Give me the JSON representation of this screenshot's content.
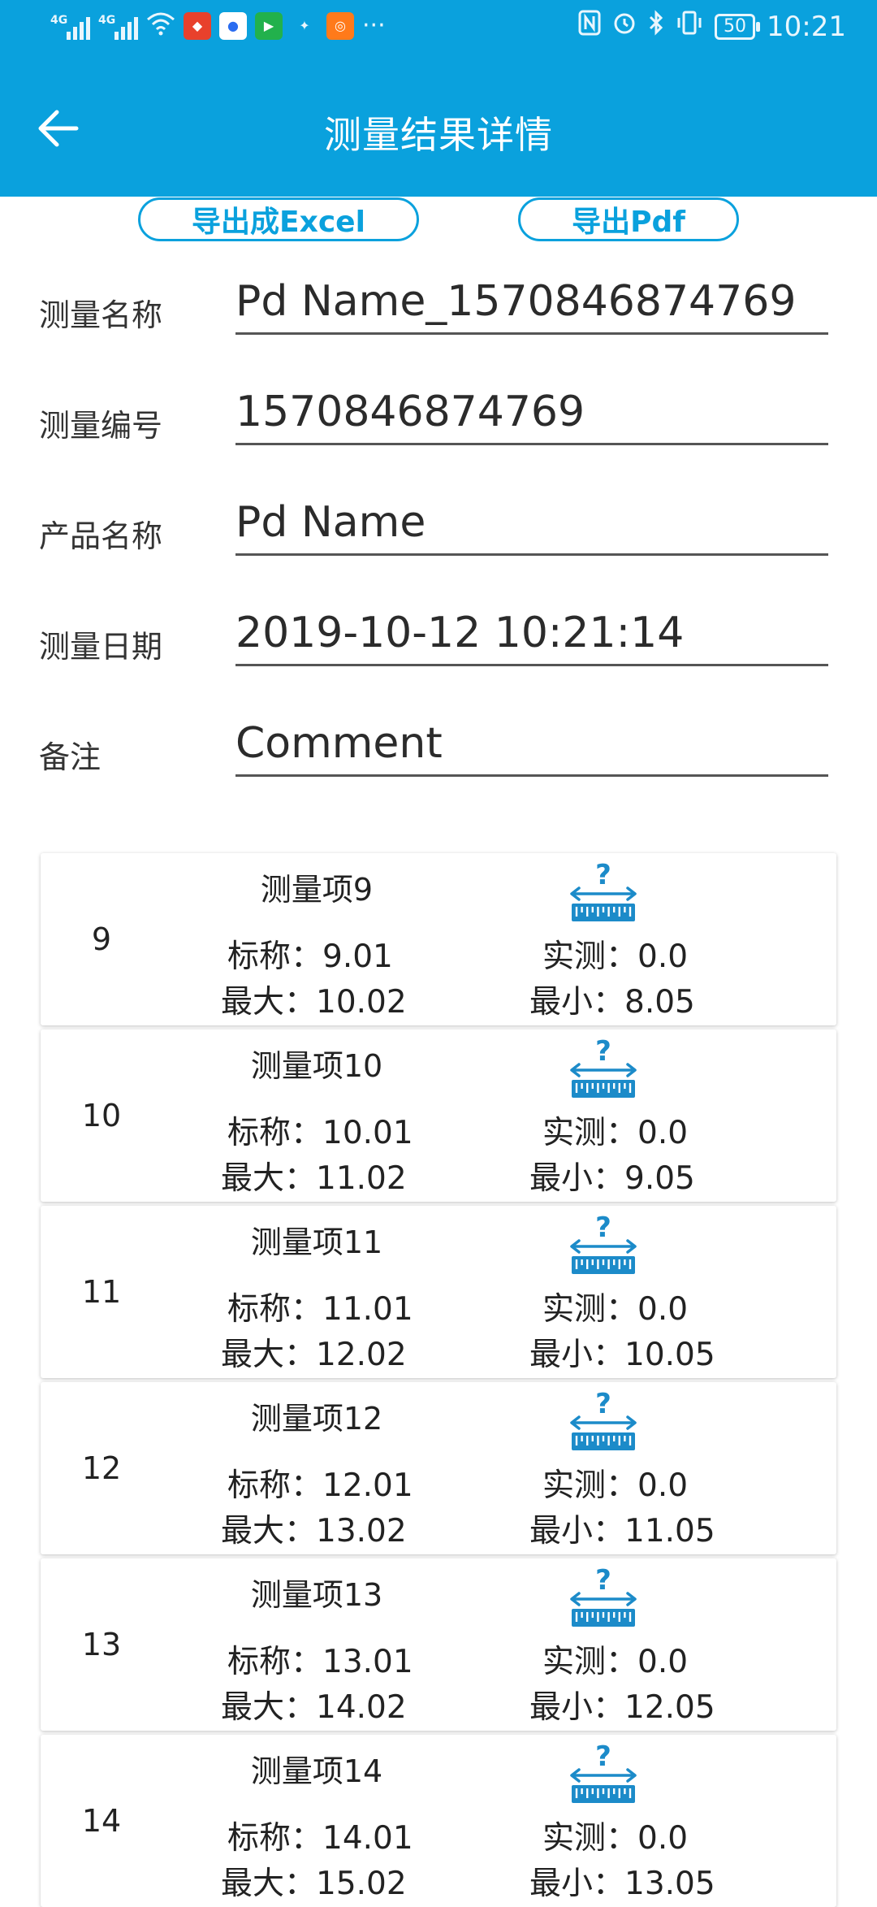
{
  "status_bar": {
    "signal_label": "4G",
    "time": "10:21",
    "battery": "50",
    "more": "···",
    "icons": [
      "signal-icon",
      "wifi-icon",
      "app-icon",
      "nfc-icon",
      "alarm-icon",
      "bluetooth-icon",
      "vibrate-icon",
      "battery-icon"
    ]
  },
  "header": {
    "title": "测量结果详情",
    "back_icon": "arrow-left-icon"
  },
  "actions": {
    "export_excel": "导出成Excel",
    "export_pdf": "导出Pdf"
  },
  "form": {
    "measure_name": {
      "label": "测量名称",
      "value": "Pd Name_1570846874769"
    },
    "measure_no": {
      "label": "测量编号",
      "value": "1570846874769"
    },
    "product_name": {
      "label": "产品名称",
      "value": "Pd Name"
    },
    "measure_date": {
      "label": "测量日期",
      "value": "2019-10-12 10:21:14"
    },
    "remark": {
      "label": "备注",
      "value": "Comment"
    }
  },
  "items": [
    {
      "index": "9",
      "name": "测量项9",
      "nominal": "标称：9.01",
      "actual": "实测：0.0",
      "max": "最大：10.02",
      "min": "最小：8.05"
    },
    {
      "index": "10",
      "name": "测量项10",
      "nominal": "标称：10.01",
      "actual": "实测：0.0",
      "max": "最大：11.02",
      "min": "最小：9.05"
    },
    {
      "index": "11",
      "name": "测量项11",
      "nominal": "标称：11.01",
      "actual": "实测：0.0",
      "max": "最大：12.02",
      "min": "最小：10.05"
    },
    {
      "index": "12",
      "name": "测量项12",
      "nominal": "标称：12.01",
      "actual": "实测：0.0",
      "max": "最大：13.02",
      "min": "最小：11.05"
    },
    {
      "index": "13",
      "name": "测量项13",
      "nominal": "标称：13.01",
      "actual": "实测：0.0",
      "max": "最大：14.02",
      "min": "最小：12.05"
    },
    {
      "index": "14",
      "name": "测量项14",
      "nominal": "标称：14.01",
      "actual": "实测：0.0",
      "max": "最大：15.02",
      "min": "最小：13.05"
    }
  ],
  "colors": {
    "primary": "#0AA1DD",
    "icon": "#1C8BC9"
  }
}
